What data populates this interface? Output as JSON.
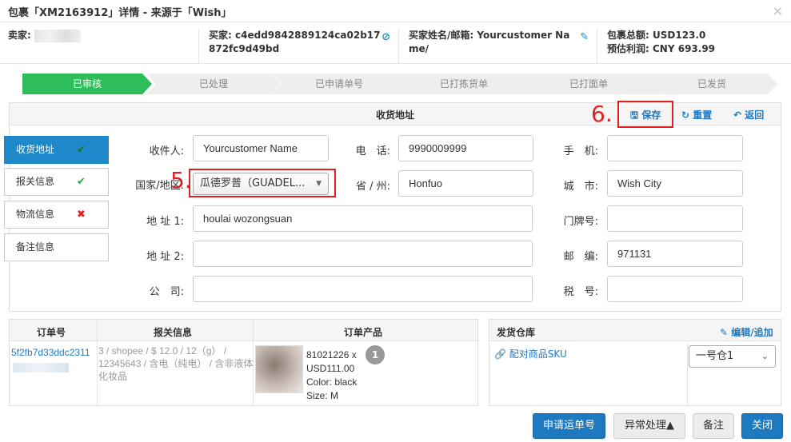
{
  "dialog": {
    "title": "包裹「XM2163912」详情 - 来源于「Wish」",
    "close_glyph": "×"
  },
  "info": {
    "seller_label": "卖家:",
    "buyer_label": "买家:",
    "buyer_line1": "c4edd9842889124ca02b17",
    "buyer_line2": "872fc9d49bd",
    "buyer_name_label": "买家姓名/邮箱:",
    "buyer_name_line1": "Yourcustomer Na",
    "buyer_name_line2": "me/",
    "total_label": "包裹总额:",
    "total_value": "USD123.0",
    "profit_label": "预估利润:",
    "profit_value": "CNY 693.99"
  },
  "steps": [
    "已审核",
    "已处理",
    "已申请单号",
    "已打拣货单",
    "已打面单",
    "已发货"
  ],
  "address_panel": {
    "title": "收货地址",
    "annotation_save": "6.",
    "save_label": "保存",
    "reset_label": "重置",
    "back_label": "返回",
    "annotation_country": "5."
  },
  "side_tabs": [
    {
      "label": "收货地址",
      "status": "✔"
    },
    {
      "label": "报关信息",
      "status": "✔"
    },
    {
      "label": "物流信息",
      "status": "✖"
    },
    {
      "label": "备注信息",
      "status": ""
    }
  ],
  "form": {
    "recipient_label": "收件人:",
    "recipient_value": "Yourcustomer Name",
    "phone_label": "电　话:",
    "phone_value": "9990009999",
    "mobile_label": "手　机:",
    "mobile_value": "",
    "country_label": "国家/地区:",
    "country_value": "瓜德罗普（GUADEL...",
    "state_label": "省 / 州:",
    "state_value": "Honfuo",
    "city_label": "城　市:",
    "city_value": "Wish City",
    "address1_label": "地 址 1:",
    "address1_value": "houlai  wozongsuan",
    "door_label": "门牌号:",
    "door_value": "",
    "address2_label": "地 址 2:",
    "address2_value": "",
    "zip_label": "邮　编:",
    "zip_value": "971131",
    "company_label": "公　司:",
    "company_value": "",
    "tax_label": "税　号:",
    "tax_value": ""
  },
  "order": {
    "col_order_no": "订单号",
    "col_customs": "报关信息",
    "col_product": "订单产品",
    "order_no": "5f2fb7d33ddc2311",
    "customs_text": "3 / shopee / $ 12.0 / 12（g） / 12345643 / 含电（纯电） / 含非液体化妆品",
    "product_line1": "81021226 x",
    "product_line2": "USD111.00",
    "product_line3": "Color:  black",
    "product_line4": "Size:  M",
    "quantity": "1"
  },
  "warehouse": {
    "title": "发货仓库",
    "edit_label": "编辑/追加",
    "match_label": "配对商品SKU",
    "selected": "一号仓1"
  },
  "buttons": {
    "apply": "申请运单号",
    "exception": "异常处理▲",
    "note": "备注",
    "close": "关闭"
  },
  "colors": {
    "primary": "#1e7ac0",
    "step_active": "#2dbd5a",
    "highlight": "#e02020"
  }
}
